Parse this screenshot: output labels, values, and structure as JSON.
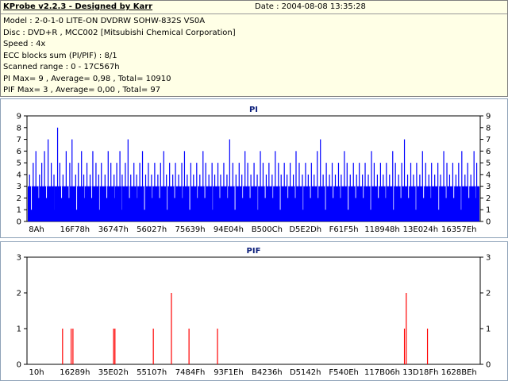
{
  "header": {
    "title": "KProbe v2.2.3 - Designed by Karr",
    "date": "Date : 2004-08-08 13:35:28"
  },
  "info_lines": [
    "Model : 2-0-1-0 LITE-ON DVDRW SOHW-832S  VS0A",
    "Disc : DVD+R , MCC002 [Mitsubishi Chemical Corporation]",
    "Speed : 4x",
    "ECC blocks sum (PI/PIF) : 8/1",
    "Scanned range : 0 - 17C567h",
    "PI Max= 9 , Average= 0,98 , Total= 10910",
    "PIF Max= 3 , Average= 0,00 , Total= 97"
  ],
  "colors": {
    "pi_bar": "#0000ff",
    "pif_bar": "#ff0000",
    "panel_border": "#8ea2b8",
    "title": "#0b1e7a"
  },
  "chart_data": [
    {
      "type": "bar",
      "title": "PI",
      "ylim": [
        0,
        9
      ],
      "yticks": [
        0,
        1,
        2,
        3,
        4,
        5,
        6,
        7,
        8,
        9
      ],
      "xticks": [
        "8Ah",
        "16F78h",
        "36747h",
        "56027h",
        "75639h",
        "94E04h",
        "B500Ch",
        "D5E2Dh",
        "F61F5h",
        "118948h",
        "13E024h",
        "16357Eh"
      ],
      "baseline": 3,
      "spikes": [
        [
          0.004,
          4
        ],
        [
          0.012,
          5
        ],
        [
          0.018,
          6
        ],
        [
          0.026,
          4
        ],
        [
          0.031,
          5
        ],
        [
          0.037,
          6
        ],
        [
          0.045,
          7
        ],
        [
          0.052,
          5
        ],
        [
          0.058,
          4
        ],
        [
          0.066,
          8
        ],
        [
          0.071,
          5
        ],
        [
          0.078,
          4
        ],
        [
          0.085,
          6
        ],
        [
          0.093,
          5
        ],
        [
          0.098,
          7
        ],
        [
          0.106,
          4
        ],
        [
          0.112,
          5
        ],
        [
          0.119,
          6
        ],
        [
          0.124,
          4
        ],
        [
          0.131,
          5
        ],
        [
          0.138,
          4
        ],
        [
          0.144,
          6
        ],
        [
          0.151,
          5
        ],
        [
          0.157,
          4
        ],
        [
          0.163,
          5
        ],
        [
          0.171,
          4
        ],
        [
          0.178,
          6
        ],
        [
          0.184,
          5
        ],
        [
          0.191,
          4
        ],
        [
          0.197,
          5
        ],
        [
          0.204,
          6
        ],
        [
          0.209,
          4
        ],
        [
          0.216,
          5
        ],
        [
          0.222,
          7
        ],
        [
          0.228,
          4
        ],
        [
          0.235,
          5
        ],
        [
          0.241,
          4
        ],
        [
          0.248,
          5
        ],
        [
          0.254,
          6
        ],
        [
          0.261,
          4
        ],
        [
          0.267,
          5
        ],
        [
          0.274,
          4
        ],
        [
          0.281,
          5
        ],
        [
          0.288,
          4
        ],
        [
          0.294,
          5
        ],
        [
          0.301,
          6
        ],
        [
          0.307,
          4
        ],
        [
          0.314,
          5
        ],
        [
          0.321,
          4
        ],
        [
          0.327,
          5
        ],
        [
          0.334,
          4
        ],
        [
          0.341,
          5
        ],
        [
          0.347,
          6
        ],
        [
          0.353,
          4
        ],
        [
          0.361,
          5
        ],
        [
          0.367,
          4
        ],
        [
          0.374,
          5
        ],
        [
          0.381,
          4
        ],
        [
          0.388,
          6
        ],
        [
          0.394,
          5
        ],
        [
          0.401,
          4
        ],
        [
          0.408,
          5
        ],
        [
          0.414,
          4
        ],
        [
          0.421,
          5
        ],
        [
          0.427,
          4
        ],
        [
          0.434,
          5
        ],
        [
          0.441,
          4
        ],
        [
          0.447,
          7
        ],
        [
          0.454,
          5
        ],
        [
          0.461,
          4
        ],
        [
          0.468,
          5
        ],
        [
          0.474,
          4
        ],
        [
          0.481,
          6
        ],
        [
          0.487,
          5
        ],
        [
          0.494,
          4
        ],
        [
          0.501,
          5
        ],
        [
          0.508,
          4
        ],
        [
          0.515,
          6
        ],
        [
          0.521,
          5
        ],
        [
          0.528,
          4
        ],
        [
          0.534,
          5
        ],
        [
          0.541,
          4
        ],
        [
          0.548,
          6
        ],
        [
          0.555,
          5
        ],
        [
          0.561,
          4
        ],
        [
          0.568,
          5
        ],
        [
          0.574,
          4
        ],
        [
          0.581,
          5
        ],
        [
          0.588,
          4
        ],
        [
          0.594,
          6
        ],
        [
          0.601,
          5
        ],
        [
          0.608,
          4
        ],
        [
          0.615,
          5
        ],
        [
          0.621,
          4
        ],
        [
          0.628,
          5
        ],
        [
          0.634,
          4
        ],
        [
          0.641,
          6
        ],
        [
          0.648,
          7
        ],
        [
          0.654,
          4
        ],
        [
          0.661,
          5
        ],
        [
          0.668,
          4
        ],
        [
          0.674,
          5
        ],
        [
          0.681,
          4
        ],
        [
          0.688,
          5
        ],
        [
          0.694,
          4
        ],
        [
          0.701,
          6
        ],
        [
          0.707,
          5
        ],
        [
          0.714,
          4
        ],
        [
          0.721,
          5
        ],
        [
          0.728,
          4
        ],
        [
          0.734,
          5
        ],
        [
          0.741,
          4
        ],
        [
          0.747,
          5
        ],
        [
          0.754,
          4
        ],
        [
          0.761,
          6
        ],
        [
          0.767,
          5
        ],
        [
          0.774,
          4
        ],
        [
          0.781,
          5
        ],
        [
          0.787,
          4
        ],
        [
          0.794,
          5
        ],
        [
          0.801,
          4
        ],
        [
          0.808,
          6
        ],
        [
          0.814,
          5
        ],
        [
          0.821,
          4
        ],
        [
          0.828,
          5
        ],
        [
          0.834,
          7
        ],
        [
          0.841,
          4
        ],
        [
          0.848,
          5
        ],
        [
          0.854,
          4
        ],
        [
          0.861,
          5
        ],
        [
          0.868,
          4
        ],
        [
          0.874,
          6
        ],
        [
          0.881,
          5
        ],
        [
          0.888,
          4
        ],
        [
          0.894,
          5
        ],
        [
          0.901,
          4
        ],
        [
          0.908,
          5
        ],
        [
          0.914,
          4
        ],
        [
          0.921,
          6
        ],
        [
          0.928,
          5
        ],
        [
          0.934,
          4
        ],
        [
          0.941,
          5
        ],
        [
          0.948,
          4
        ],
        [
          0.954,
          5
        ],
        [
          0.961,
          6
        ],
        [
          0.968,
          4
        ],
        [
          0.974,
          5
        ],
        [
          0.981,
          4
        ],
        [
          0.988,
          6
        ],
        [
          0.994,
          5
        ]
      ]
    },
    {
      "type": "bar",
      "title": "PIF",
      "ylim": [
        0,
        3
      ],
      "yticks": [
        0,
        1,
        2,
        3
      ],
      "xticks": [
        "10h",
        "16289h",
        "35E02h",
        "55107h",
        "7484Fh",
        "93F1Eh",
        "B4236h",
        "D5142h",
        "F540Eh",
        "117B06h",
        "13D18Fh",
        "1628BEh"
      ],
      "spikes": [
        [
          0.077,
          1
        ],
        [
          0.096,
          1
        ],
        [
          0.1,
          1
        ],
        [
          0.19,
          1
        ],
        [
          0.193,
          1
        ],
        [
          0.278,
          1
        ],
        [
          0.318,
          2
        ],
        [
          0.357,
          1
        ],
        [
          0.42,
          1
        ],
        [
          0.834,
          1
        ],
        [
          0.838,
          2
        ],
        [
          0.885,
          1
        ]
      ]
    }
  ]
}
